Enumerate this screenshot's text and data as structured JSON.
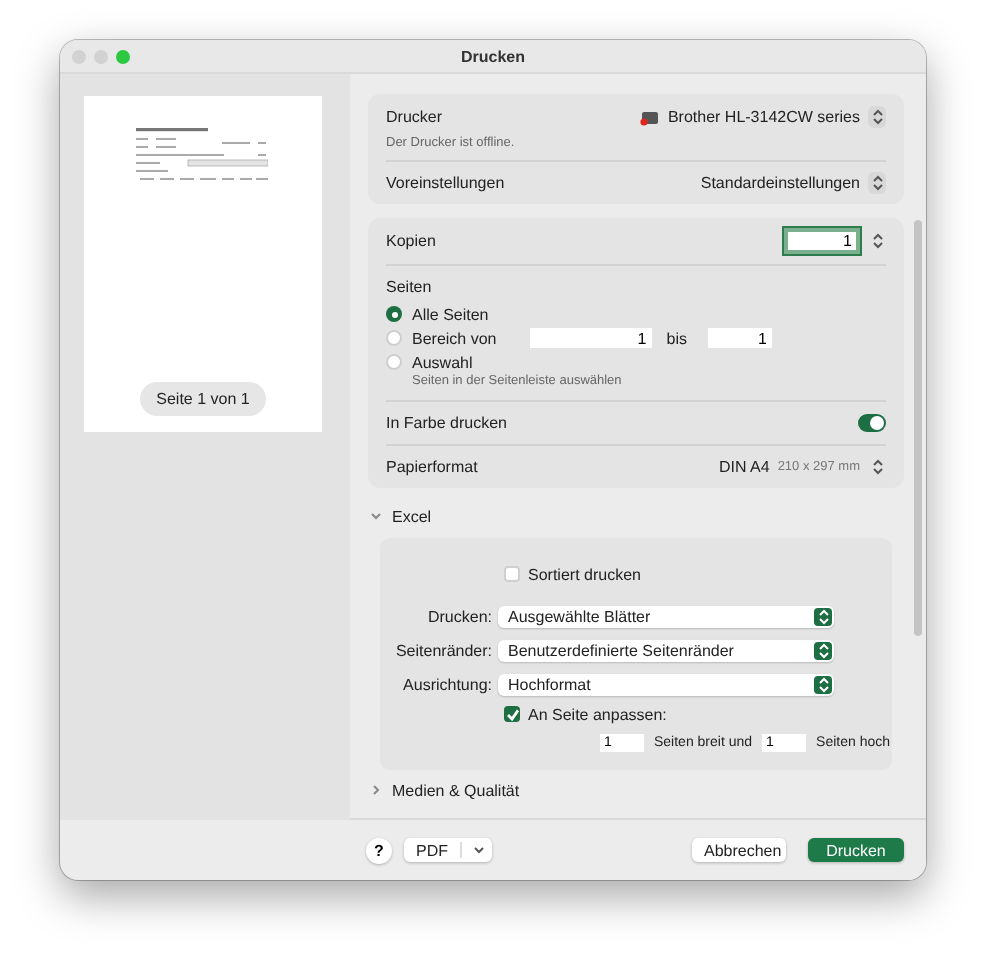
{
  "window": {
    "title": "Drucken"
  },
  "preview": {
    "page_label": "Seite 1 von 1"
  },
  "printer": {
    "label": "Drucker",
    "value": "Brother HL-3142CW series",
    "status": "Der Drucker ist offline."
  },
  "presets": {
    "label": "Voreinstellungen",
    "value": "Standardeinstellungen"
  },
  "copies": {
    "label": "Kopien",
    "value": "1"
  },
  "pages": {
    "label": "Seiten",
    "options": [
      {
        "label": "Alle Seiten",
        "selected": true
      },
      {
        "label": "Bereich von",
        "selected": false
      },
      {
        "label": "Auswahl",
        "selected": false
      }
    ],
    "range_from": "1",
    "range_separator": "bis",
    "range_to": "1",
    "selection_hint": "Seiten in der Seitenleiste auswählen"
  },
  "color": {
    "label": "In Farbe drucken",
    "on": true
  },
  "paper": {
    "label": "Papierformat",
    "value": "DIN A4",
    "size": "210 x 297 mm"
  },
  "excel": {
    "title": "Excel",
    "expanded": true,
    "collate": {
      "label": "Sortiert drucken",
      "checked": false
    },
    "selects": [
      {
        "label": "Drucken:",
        "value": "Ausgewählte Blätter"
      },
      {
        "label": "Seitenränder:",
        "value": "Benutzerdefinierte Seitenränder"
      },
      {
        "label": "Ausrichtung:",
        "value": "Hochformat"
      }
    ],
    "fit": {
      "label": "An Seite anpassen:",
      "checked": true,
      "wide_value": "1",
      "wide_label": "Seiten breit und",
      "tall_value": "1",
      "tall_label": "Seiten hoch"
    }
  },
  "media": {
    "title": "Medien & Qualität",
    "expanded": false
  },
  "footer": {
    "help": "?",
    "pdf": "PDF",
    "buttons": [
      {
        "label": "Abbrechen",
        "kind": "secondary"
      },
      {
        "label": "Drucken",
        "kind": "primary"
      }
    ]
  }
}
